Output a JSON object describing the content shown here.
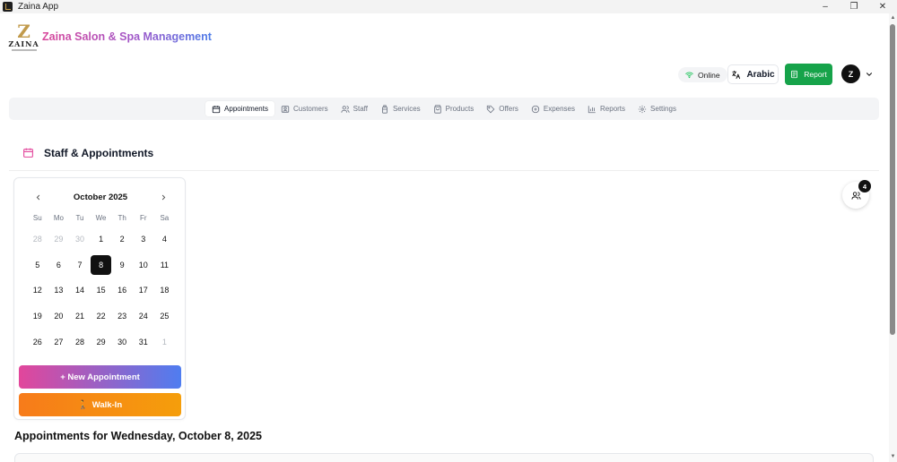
{
  "window": {
    "title": "Zaina App"
  },
  "header": {
    "logo_mark": "Z",
    "logo_text": "ZAINA",
    "brand_title": "Zaina Salon & Spa Management",
    "status": "Online",
    "language_button": "Arabic",
    "report_button": "Report",
    "avatar_initial": "Z"
  },
  "tabs": [
    {
      "label": "Appointments",
      "icon": "calendar-icon",
      "active": true
    },
    {
      "label": "Customers",
      "icon": "id-card-icon"
    },
    {
      "label": "Staff",
      "icon": "users-icon"
    },
    {
      "label": "Services",
      "icon": "bottle-icon"
    },
    {
      "label": "Products",
      "icon": "shopping-bag-icon"
    },
    {
      "label": "Offers",
      "icon": "tag-icon"
    },
    {
      "label": "Expenses",
      "icon": "wallet-icon"
    },
    {
      "label": "Reports",
      "icon": "bar-chart-icon"
    },
    {
      "label": "Settings",
      "icon": "gear-icon"
    }
  ],
  "section": {
    "title": "Staff & Appointments"
  },
  "calendar": {
    "month_label": "October 2025",
    "weekdays": [
      "Su",
      "Mo",
      "Tu",
      "We",
      "Th",
      "Fr",
      "Sa"
    ],
    "selected_day": "8",
    "weeks": [
      [
        {
          "d": "28",
          "muted": true
        },
        {
          "d": "29",
          "muted": true
        },
        {
          "d": "30",
          "muted": true
        },
        {
          "d": "1"
        },
        {
          "d": "2"
        },
        {
          "d": "3"
        },
        {
          "d": "4"
        }
      ],
      [
        {
          "d": "5"
        },
        {
          "d": "6"
        },
        {
          "d": "7"
        },
        {
          "d": "8",
          "selected": true
        },
        {
          "d": "9"
        },
        {
          "d": "10"
        },
        {
          "d": "11"
        }
      ],
      [
        {
          "d": "12"
        },
        {
          "d": "13"
        },
        {
          "d": "14"
        },
        {
          "d": "15"
        },
        {
          "d": "16"
        },
        {
          "d": "17"
        },
        {
          "d": "18"
        }
      ],
      [
        {
          "d": "19"
        },
        {
          "d": "20"
        },
        {
          "d": "21"
        },
        {
          "d": "22"
        },
        {
          "d": "23"
        },
        {
          "d": "24"
        },
        {
          "d": "25"
        }
      ],
      [
        {
          "d": "26"
        },
        {
          "d": "27"
        },
        {
          "d": "28"
        },
        {
          "d": "29"
        },
        {
          "d": "30"
        },
        {
          "d": "31"
        },
        {
          "d": "1",
          "muted": true
        }
      ]
    ],
    "new_appointment_label": "+ New Appointment",
    "walk_in_icon": "🚶",
    "walk_in_label": "Walk-In"
  },
  "staff_panel": {
    "badge_count": "4"
  },
  "appointments": {
    "heading": "Appointments for Wednesday, October 8, 2025"
  },
  "colors": {
    "brand_gradient": [
      "#d9479a",
      "#4b7be8"
    ],
    "report_green": "#16a34a",
    "walk_in_orange": "#f77b1a",
    "selected_day": "#111111",
    "section_icon": "#e2469b"
  }
}
